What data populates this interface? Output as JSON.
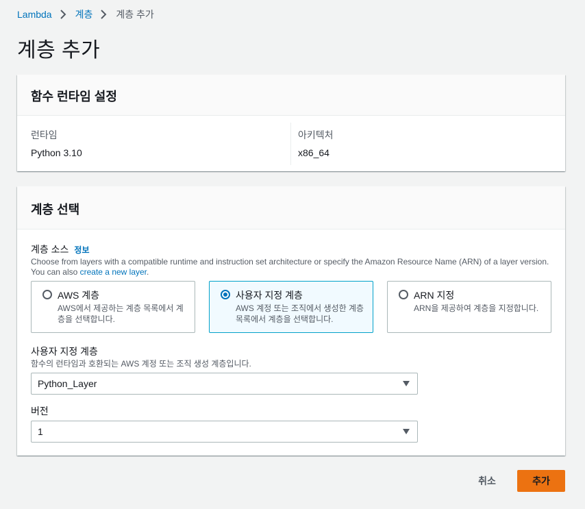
{
  "breadcrumb": {
    "items": [
      "Lambda",
      "계층",
      "계층 추가"
    ]
  },
  "page": {
    "title": "계층 추가"
  },
  "runtime_panel": {
    "header": "함수 런타임 설정",
    "runtime_label": "런타임",
    "runtime_value": "Python 3.10",
    "arch_label": "아키텍처",
    "arch_value": "x86_64"
  },
  "layer_panel": {
    "header": "계층 선택",
    "source_label": "계층 소스",
    "info_link": "정보",
    "source_desc": "Choose from layers with a compatible runtime and instruction set architecture or specify the Amazon Resource Name (ARN) of a layer version. You can also ",
    "source_desc_link": "create a new layer",
    "source_desc_end": ".",
    "options": [
      {
        "title": "AWS 계층",
        "desc": "AWS에서 제공하는 계층 목록에서 계층을 선택합니다.",
        "selected": false
      },
      {
        "title": "사용자 지정 계층",
        "desc": "AWS 계정 또는 조직에서 생성한 계층 목록에서 계층을 선택합니다.",
        "selected": true
      },
      {
        "title": "ARN 지정",
        "desc": "ARN을 제공하여 계층을 지정합니다.",
        "selected": false
      }
    ],
    "custom_label": "사용자 지정 계층",
    "custom_desc": "함수의 런타임과 호환되는 AWS 계정 또는 조직 생성 계층입니다.",
    "custom_value": "Python_Layer",
    "version_label": "버전",
    "version_value": "1"
  },
  "actions": {
    "cancel": "취소",
    "add": "추가"
  },
  "colors": {
    "accent": "#0073bb",
    "primary_button": "#ec7211",
    "selected_tile_border": "#00a1c9"
  }
}
